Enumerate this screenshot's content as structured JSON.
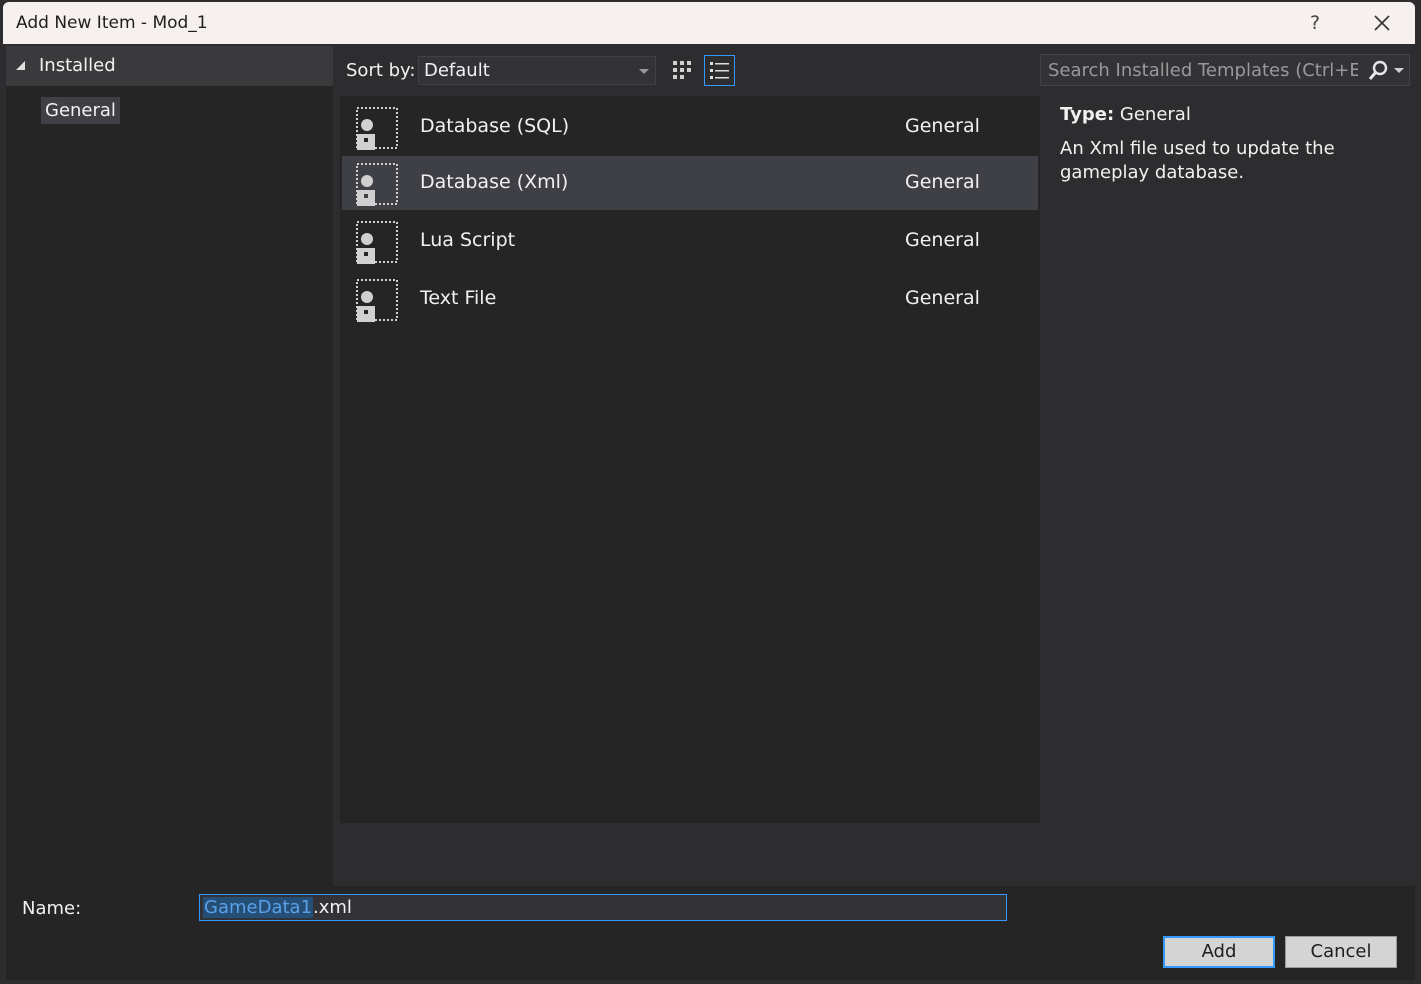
{
  "window": {
    "title": "Add New Item - Mod_1",
    "help_label": "?",
    "close_icon": "close-icon"
  },
  "tree": {
    "installed_label": "Installed",
    "categories": [
      {
        "label": "General",
        "selected": true
      }
    ]
  },
  "toolbar": {
    "sort_label": "Sort by:",
    "sort_value": "Default",
    "views": [
      {
        "icon": "grid-view-icon",
        "active": false
      },
      {
        "icon": "list-view-icon",
        "active": true
      }
    ]
  },
  "search": {
    "placeholder": "Search Installed Templates (Ctrl+E)",
    "icon": "search-icon"
  },
  "templates": [
    {
      "name": "Database (SQL)",
      "category": "General",
      "selected": false,
      "icon": "template-icon"
    },
    {
      "name": "Database (Xml)",
      "category": "General",
      "selected": true,
      "icon": "template-icon"
    },
    {
      "name": "Lua Script",
      "category": "General",
      "selected": false,
      "icon": "template-icon"
    },
    {
      "name": "Text File",
      "category": "General",
      "selected": false,
      "icon": "template-icon"
    }
  ],
  "details": {
    "type_label": "Type:",
    "type_value": "General",
    "description": "An Xml file used to update the gameplay database."
  },
  "footer": {
    "name_label": "Name:",
    "name_selected": "GameData1",
    "name_extension": ".xml",
    "add_label": "Add",
    "cancel_label": "Cancel"
  },
  "colors": {
    "accent": "#3399ff",
    "background": "#2d2d30",
    "panel": "#252526",
    "selection": "#3f3f46"
  }
}
